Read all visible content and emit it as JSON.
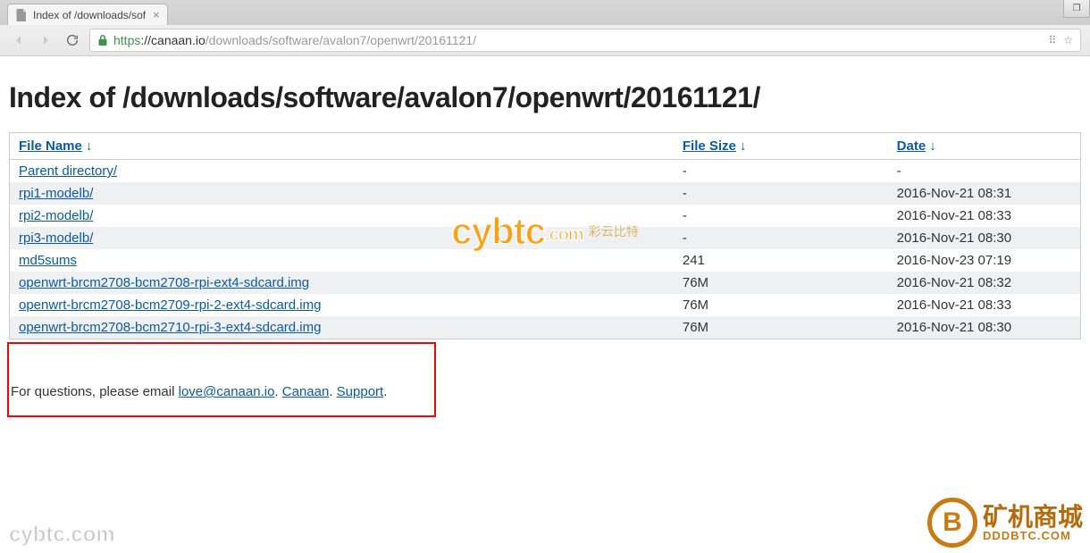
{
  "browser": {
    "tab_title": "Index of /downloads/sof",
    "url_scheme": "https",
    "url_host": "://canaan.io",
    "url_path": "/downloads/software/avalon7/openwrt/20161121/"
  },
  "page": {
    "heading": "Index of /downloads/software/avalon7/openwrt/20161121/",
    "columns": {
      "name": "File Name",
      "size": "File Size",
      "date": "Date",
      "arrow": "↓"
    },
    "rows": [
      {
        "name": "Parent directory/",
        "size": "-",
        "date": "-",
        "link": true
      },
      {
        "name": "rpi1-modelb/",
        "size": "-",
        "date": "2016-Nov-21 08:31",
        "link": true
      },
      {
        "name": "rpi2-modelb/",
        "size": "-",
        "date": "2016-Nov-21 08:33",
        "link": true
      },
      {
        "name": "rpi3-modelb/",
        "size": "-",
        "date": "2016-Nov-21 08:30",
        "link": true
      },
      {
        "name": "md5sums",
        "size": "241",
        "date": "2016-Nov-23 07:19",
        "link": true
      },
      {
        "name": "openwrt-brcm2708-bcm2708-rpi-ext4-sdcard.img",
        "size": "76M",
        "date": "2016-Nov-21 08:32",
        "link": true
      },
      {
        "name": "openwrt-brcm2708-bcm2709-rpi-2-ext4-sdcard.img",
        "size": "76M",
        "date": "2016-Nov-21 08:33",
        "link": true
      },
      {
        "name": "openwrt-brcm2708-bcm2710-rpi-3-ext4-sdcard.img",
        "size": "76M",
        "date": "2016-Nov-21 08:30",
        "link": true
      }
    ],
    "footer_pre": "For questions, please email ",
    "footer_email": "love@canaan.io",
    "footer_sep1": ". ",
    "footer_link2": "Canaan",
    "footer_sep2": ". ",
    "footer_link3": "Support",
    "footer_end": "."
  },
  "watermarks": {
    "cybtc": "cybtc",
    "cybtc_dom": ".com",
    "cybtc_cn": "彩云比特",
    "cybtc_bl": "cybtc.com",
    "dddbtc_cn": "矿机商城",
    "dddbtc_en": "DDDBTC.COM",
    "coin": "B"
  }
}
